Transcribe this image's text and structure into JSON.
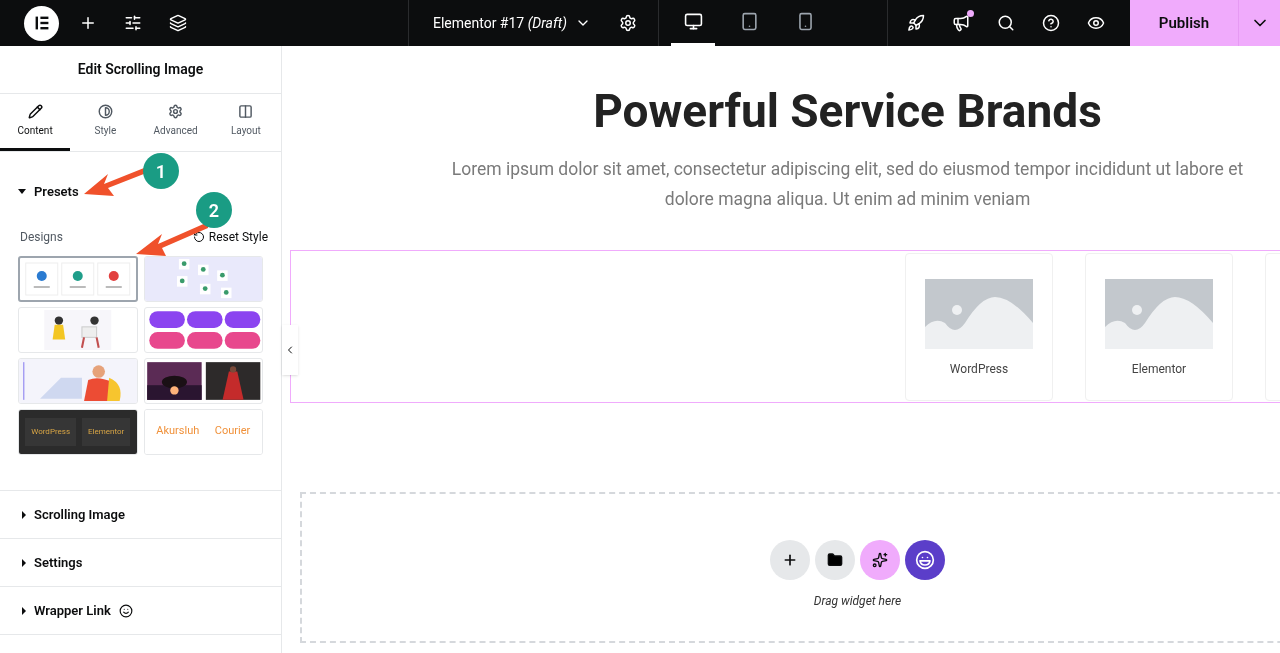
{
  "topbar": {
    "document_title": "Elementor #17 *(Draft)*",
    "devices": [
      {
        "kind": "desktop",
        "selected": true
      },
      {
        "kind": "tablet",
        "selected": false
      },
      {
        "kind": "mobile",
        "selected": false
      }
    ],
    "notification": true,
    "publish": "Publish"
  },
  "panel": {
    "title": "Edit Scrolling Image",
    "tabs": [
      {
        "label": "Content",
        "selected": true
      },
      {
        "label": "Style",
        "selected": false
      },
      {
        "label": "Advanced",
        "selected": false
      },
      {
        "label": "Layout",
        "selected": false
      }
    ],
    "presets": {
      "title": "Presets",
      "expanded": true,
      "designs_label": "Designs",
      "reset": "Reset Style",
      "designs": [
        {
          "kind": "logos",
          "selected": true
        },
        {
          "kind": "scattered",
          "selected": false
        },
        {
          "kind": "illustration",
          "selected": false
        },
        {
          "kind": "pills",
          "selected": false
        },
        {
          "kind": "person",
          "selected": false
        },
        {
          "kind": "photos",
          "selected": false
        },
        {
          "kind": "dark-text",
          "selected": false,
          "labels": [
            "WordPress",
            "Elementor"
          ]
        },
        {
          "kind": "light-text",
          "selected": false,
          "labels": [
            "Akursluh",
            "Courier"
          ]
        }
      ]
    },
    "sections": [
      {
        "title": "Scrolling Image",
        "expanded": false
      },
      {
        "title": "Settings",
        "expanded": false
      },
      {
        "title": "Wrapper Link",
        "expanded": false,
        "badge": true
      }
    ]
  },
  "annotations": [
    {
      "label": "1"
    },
    {
      "label": "2"
    }
  ],
  "canvas": {
    "heading": "Powerful Service Brands",
    "text": "Lorem ipsum dolor sit amet, consectetur adipiscing elit, sed do eiusmod tempor incididunt ut labore et dolore magna aliqua. Ut enim ad minim veniam",
    "cards": [
      {
        "label": "WordPress"
      },
      {
        "label": "Elementor"
      }
    ],
    "dropzone": "Drag widget here"
  }
}
